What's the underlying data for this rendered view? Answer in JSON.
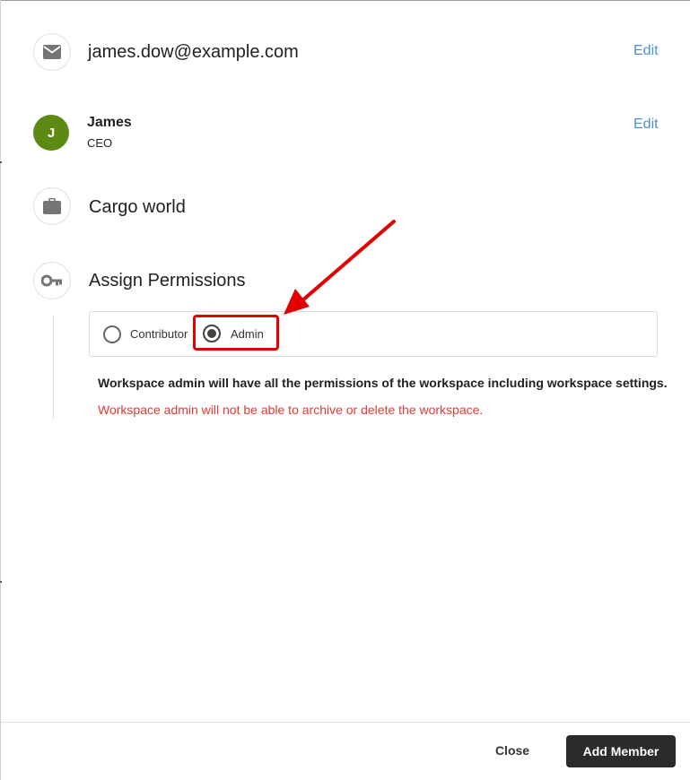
{
  "email_row": {
    "email": "james.dow@example.com",
    "edit_label": "Edit",
    "icon": "mail-icon"
  },
  "user_row": {
    "avatar_initial": "J",
    "name": "James",
    "role": "CEO",
    "edit_label": "Edit",
    "avatar_color": "#5c8a12"
  },
  "workspace_row": {
    "name": "Cargo world",
    "icon": "briefcase-icon"
  },
  "permissions": {
    "title": "Assign Permissions",
    "icon": "key-icon",
    "options": [
      {
        "label": "Contributor",
        "checked": false
      },
      {
        "label": "Admin",
        "checked": true
      }
    ],
    "description": "Workspace admin will have all the permissions of the workspace including workspace settings.",
    "warning": "Workspace admin will not be able to archive or delete the workspace."
  },
  "footer": {
    "close_label": "Close",
    "add_label": "Add Member"
  },
  "colors": {
    "link": "#4a90d9",
    "warning": "#e53935",
    "highlight": "#e30000",
    "primary_button": "#2b2b2b"
  }
}
